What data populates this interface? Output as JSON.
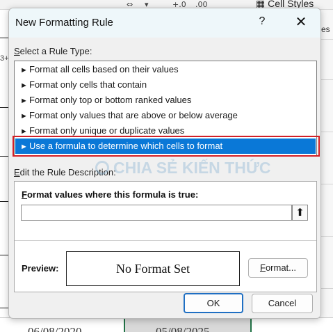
{
  "background": {
    "ribbon_cell_styles_label": "Cell Styles",
    "ribbon_fragment_1": "+.0",
    "ribbon_fragment_2": ".00",
    "right_edge_text": "es",
    "left_edge_text": "3+",
    "sheet_dates": [
      "06/08/2020",
      "05/08/2025"
    ]
  },
  "dialog": {
    "title": "New Formatting Rule",
    "help_label": "?",
    "close_label": "✕",
    "rule_type_label_prefix": "S",
    "rule_type_label_rest": "elect a Rule Type:",
    "rule_types": [
      "Format all cells based on their values",
      "Format only cells that contain",
      "Format only top or bottom ranked values",
      "Format only values that are above or below average",
      "Format only unique or duplicate values",
      "Use a formula to determine which cells to format"
    ],
    "selected_rule_index": 5,
    "edit_label_prefix": "E",
    "edit_label_rest": "dit the Rule Description:",
    "formula_label_prefix": "F",
    "formula_label_rest": "ormat values where this formula is true:",
    "formula_value": "",
    "collapse_icon_glyph": "⬆",
    "preview_label": "Preview:",
    "preview_text": "No Format Set",
    "format_button_prefix": "F",
    "format_button_rest": "ormat...",
    "ok_label": "OK",
    "cancel_label": "Cancel"
  },
  "watermark": {
    "text": "CHIA SẺ KIẾN THỨC"
  },
  "colors": {
    "selection": "#0a78d7",
    "highlight_outline": "#d21f26",
    "title_bar": "#eef7fa",
    "dialog_bg": "#f0f0f0"
  }
}
